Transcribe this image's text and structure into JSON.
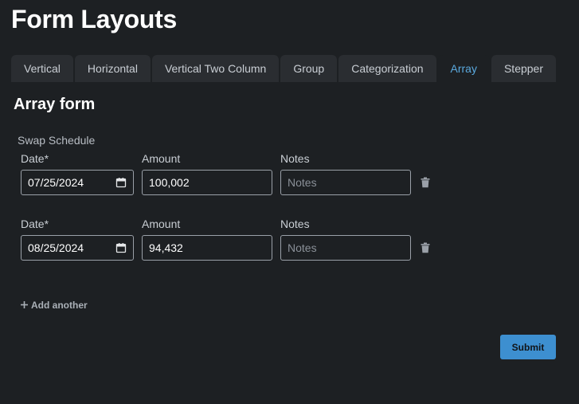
{
  "page_title": "Form Layouts",
  "tabs": [
    {
      "label": "Vertical",
      "active": false
    },
    {
      "label": "Horizontal",
      "active": false
    },
    {
      "label": "Vertical Two Column",
      "active": false
    },
    {
      "label": "Group",
      "active": false
    },
    {
      "label": "Categorization",
      "active": false
    },
    {
      "label": "Array",
      "active": true
    },
    {
      "label": "Stepper",
      "active": false
    }
  ],
  "form": {
    "title": "Array form",
    "array_label": "Swap Schedule",
    "labels": {
      "date": "Date*",
      "amount": "Amount",
      "notes": "Notes"
    },
    "rows": [
      {
        "date": "07/25/2024",
        "amount": "100,002",
        "notes": "",
        "notes_placeholder": "Notes"
      },
      {
        "date": "08/25/2024",
        "amount": "94,432",
        "notes": "",
        "notes_placeholder": "Notes"
      }
    ],
    "add_another_label": "Add another",
    "submit_label": "Submit"
  },
  "colors": {
    "background": "#1d2023",
    "tab_background": "#2a2d31",
    "accent": "#5aa9de",
    "submit": "#3d8fd0"
  },
  "icons": {
    "calendar": "calendar-icon",
    "delete": "trash-icon",
    "add": "plus-icon"
  }
}
